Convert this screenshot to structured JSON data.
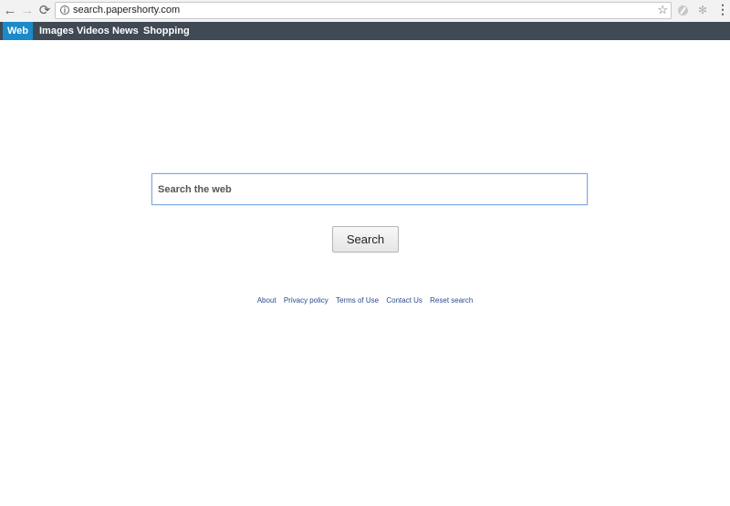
{
  "browser": {
    "back_icon": "←",
    "forward_icon": "→",
    "reload_icon": "⟳",
    "url": "search.papershorty.com",
    "bookmark_icon": "☆",
    "menu_icon": "⋮"
  },
  "site_nav": {
    "tabs": [
      {
        "label": "Web",
        "active": true
      },
      {
        "label": "Images",
        "active": false
      },
      {
        "label": "Videos",
        "active": false
      },
      {
        "label": "News",
        "active": false
      },
      {
        "label": "Shopping",
        "active": false
      }
    ]
  },
  "search": {
    "placeholder": "Search the web",
    "value": "",
    "button_label": "Search"
  },
  "footer": {
    "links": [
      "About",
      "Privacy policy",
      "Terms of Use",
      "Contact Us",
      "Reset search"
    ]
  },
  "colors": {
    "nav_bg": "#404a55",
    "active_tab": "#1a8ac9",
    "link": "#2a4a8a"
  }
}
